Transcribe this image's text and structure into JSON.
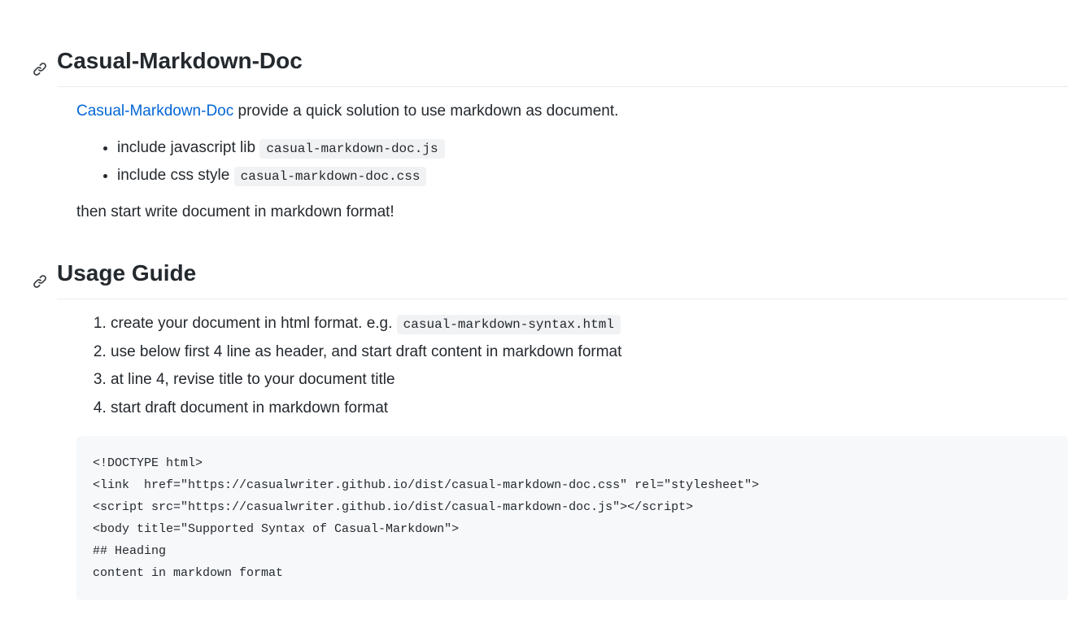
{
  "heading1": "Casual-Markdown-Doc",
  "intro": {
    "link_text": "Casual-Markdown-Doc",
    "after_link": " provide a quick solution to use markdown as document."
  },
  "bullets": [
    {
      "text": "include javascript lib ",
      "code": "casual-markdown-doc.js"
    },
    {
      "text": "include css style ",
      "code": "casual-markdown-doc.css"
    }
  ],
  "then_text": "then start write document in markdown format!",
  "heading2": "Usage Guide",
  "steps": [
    {
      "text": "create your document in html format. e.g. ",
      "code": "casual-markdown-syntax.html"
    },
    {
      "text": "use below first 4 line as header, and start draft content in markdown format"
    },
    {
      "text": "at line 4, revise title to your document title"
    },
    {
      "text": "start draft document in markdown format"
    }
  ],
  "code_block": "<!DOCTYPE html>\n<link  href=\"https://casualwriter.github.io/dist/casual-markdown-doc.css\" rel=\"stylesheet\">\n<script src=\"https://casualwriter.github.io/dist/casual-markdown-doc.js\"></script>\n<body title=\"Supported Syntax of Casual-Markdown\">\n## Heading\ncontent in markdown format"
}
